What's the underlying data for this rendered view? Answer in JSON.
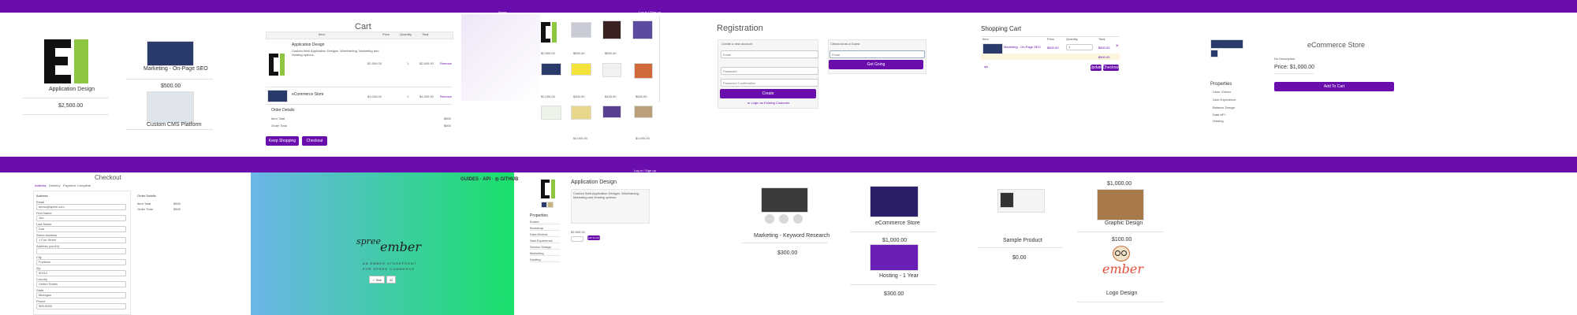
{
  "panel1": {
    "product_title": "Application Design",
    "product_price": "$2,500.00",
    "items": [
      {
        "title": "Marketing - On-Page SEO",
        "price": "$500.00"
      },
      {
        "title": "Custom CMS Platform"
      }
    ]
  },
  "cart": {
    "title": "Cart",
    "headers": [
      "Item",
      "Price",
      "Quantity",
      "Total"
    ],
    "rows": [
      {
        "name": "Application Design",
        "desc": "Custom Web Application Designs. Wireframing, Marketing and Hosting options.",
        "price": "$2,500.00",
        "qty": "1",
        "total": "$2,500.00",
        "remove": "Remove"
      },
      {
        "name": "eCommerce Store",
        "price": "$1,000.00",
        "qty": "1",
        "total": "$1,000.00",
        "remove": "Remove"
      }
    ],
    "order_details_label": "Order Details",
    "item_total_label": "Item Total",
    "item_total": "$500",
    "order_total_label": "Order Total",
    "order_total": "$500",
    "keep_shopping": "Keep Shopping",
    "checkout": "Checkout"
  },
  "grid": {
    "nav_home": "Home",
    "nav_login": "Log in / Sign up",
    "prices": [
      "$2,500.00",
      "$500.00",
      "$500.00",
      "$1,000.00",
      "$300.00",
      "$100.00",
      "$500.00",
      "$1,000.00",
      "$1,000.00"
    ]
  },
  "registration": {
    "title": "Registration",
    "create_label": "Create a new account",
    "email_ph": "Email",
    "password_ph": "Password",
    "confirm_ph": "Password Confirmation",
    "create_button": "Create",
    "login_link": "or Login as Existing Customer",
    "guest_label": "Checkout as a Guest",
    "guest_email_ph": "Email",
    "guest_button": "Get Going"
  },
  "shopping_cart": {
    "title": "Shopping Cart",
    "headers": [
      "Item",
      "Price",
      "Quantity",
      "Total"
    ],
    "row_name": "Marketing - On-Page SEO",
    "row_price": "$500.00",
    "row_qty": "1",
    "row_total": "$500.00",
    "subtotal": "$500.00",
    "update": "Update",
    "checkout": "Checkout"
  },
  "ecommerce": {
    "title": "eCommerce Store",
    "description": "No Description.",
    "price_label": "Price: $1,000.00",
    "add_to_cart": "Add To Cart",
    "properties_title": "Properties",
    "properties": [
      "Uses: Ember",
      "User Experience",
      "Balance Design",
      "Data API",
      "Hosting"
    ]
  },
  "checkout": {
    "title": "Checkout",
    "steps": [
      "Address",
      "Delivery",
      "Payment",
      "Complete"
    ],
    "address_title": "Address",
    "order_details": "Order Details",
    "item_total_label": "Item Total",
    "item_total": "$500",
    "order_total_label": "Order Total",
    "order_total": "$500",
    "fields": [
      "Email",
      "First Name",
      "Last Name",
      "Street Address",
      "Address (cont'd)",
      "City",
      "Zip",
      "Country",
      "State",
      "Phone"
    ],
    "values": [
      "demo@spree.com",
      "Jon",
      "Doe",
      "1 Fun Street",
      "",
      "Funtown",
      "90210",
      "United States",
      "Michigan",
      "555-5555"
    ]
  },
  "ember_splash": {
    "nav": "GUIDES · API · ◎ GITHUB",
    "logo_spree": "spree",
    "logo_ember": "ember",
    "tagline1": "AN EMBER STOREFRONT",
    "tagline2": "FOR SPREE COMMERCE",
    "star_label": "☆ Star",
    "star_count": "42"
  },
  "appdesign": {
    "title": "Application Design",
    "description": "Custom Web Application Designs. Wireframing, Marketing and Hosting options.",
    "properties_title": "Properties",
    "properties": [
      "Ember",
      "Bootstrap",
      "Data Models",
      "Vast Experience",
      "Service Design",
      "Marketing",
      "Hosting"
    ],
    "price": "$2,500.00",
    "button": "Add To Cart",
    "nav_login": "Log in / Sign up"
  },
  "listing": {
    "items": [
      {
        "title": "Marketing - Keyword Research",
        "price": "$300.00"
      },
      {
        "title": "eCommerce Store",
        "price": "$1,000.00"
      },
      {
        "title": "Hosting - 1 Year",
        "price": "$300.00"
      }
    ]
  },
  "sample": {
    "title": "Sample Product",
    "price": "$0.00"
  },
  "right_list": {
    "items": [
      {
        "price_top": "$1,000.00",
        "title": "Graphic Design"
      },
      {
        "price_top": "$100.00",
        "title": "Logo Design"
      }
    ],
    "ember_logo": "ember"
  },
  "colors": {
    "brand": "#6a0dad",
    "lime": "#8dc63f",
    "gradient_start": "#6cb5e8",
    "gradient_end": "#19e06a"
  }
}
